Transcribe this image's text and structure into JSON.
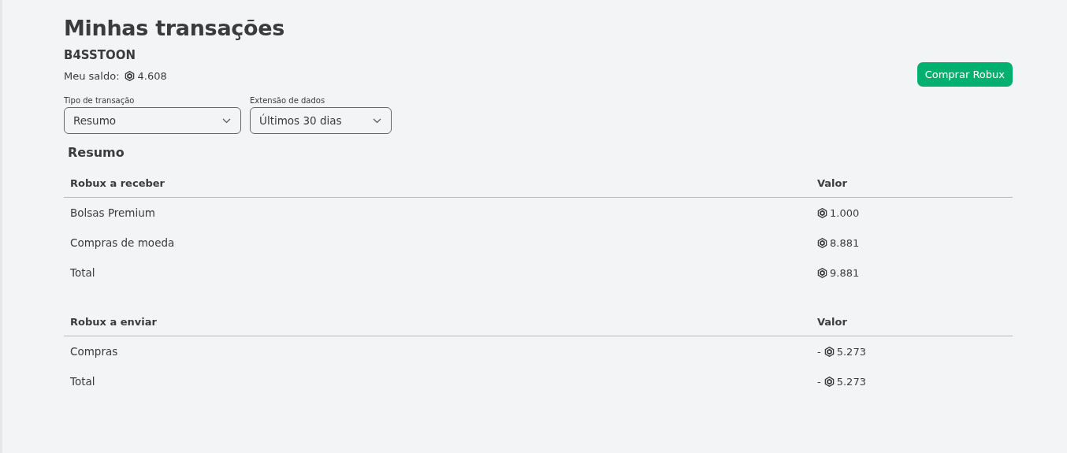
{
  "page": {
    "title": "Minhas transações",
    "username": "B4SSTOON",
    "balance_label": "Meu saldo:",
    "balance": "4.608",
    "buy_button": "Comprar Robux"
  },
  "filters": [
    {
      "label": "Tipo de transação",
      "value": "Resumo"
    },
    {
      "label": "Extensão de dados",
      "value": "Últimos 30 dias"
    }
  ],
  "summary": {
    "heading": "Resumo",
    "tables": [
      {
        "columns": [
          "Robux a receber",
          "Valor"
        ],
        "rows": [
          {
            "label": "Bolsas Premium",
            "amount": "1.000"
          },
          {
            "label": "Compras de moeda",
            "amount": "8.881"
          },
          {
            "label": "Total",
            "amount": "9.881"
          }
        ]
      },
      {
        "columns": [
          "Robux a enviar",
          "Valor"
        ],
        "rows": [
          {
            "label": "Compras",
            "sign": "-",
            "amount": "5.273"
          },
          {
            "label": "Total",
            "sign": "-",
            "amount": "5.273"
          }
        ]
      }
    ]
  }
}
